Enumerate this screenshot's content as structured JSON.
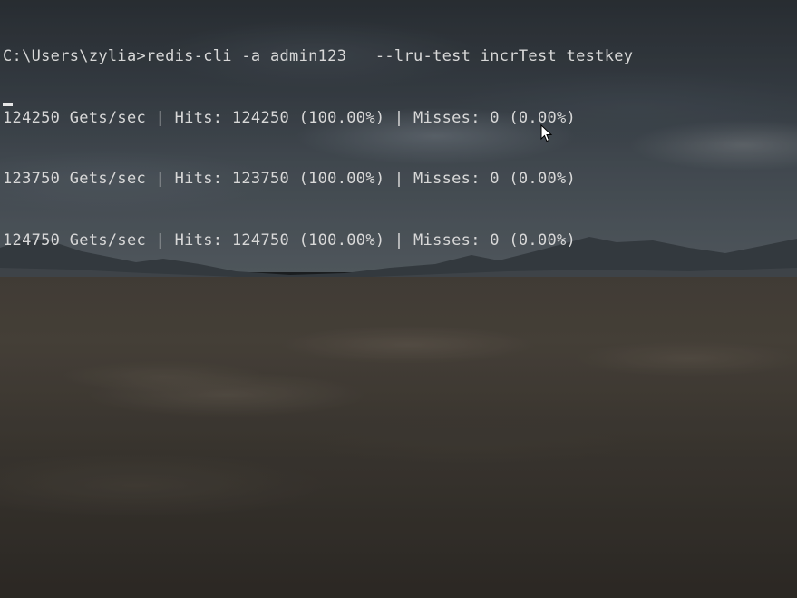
{
  "console": {
    "lines": [
      "C:\\Users\\zylia>redis-cli -a admin123   --lru-test incrTest testkey",
      "124250 Gets/sec | Hits: 124250 (100.00%) | Misses: 0 (0.00%)",
      "123750 Gets/sec | Hits: 123750 (100.00%) | Misses: 0 (0.00%)",
      "124750 Gets/sec | Hits: 124750 (100.00%) | Misses: 0 (0.00%)"
    ]
  },
  "icons": {
    "caret": "text-cursor-icon",
    "pointer": "mouse-pointer-icon"
  },
  "colors": {
    "text": "#d8d8d8",
    "background": "#1c1f22"
  }
}
